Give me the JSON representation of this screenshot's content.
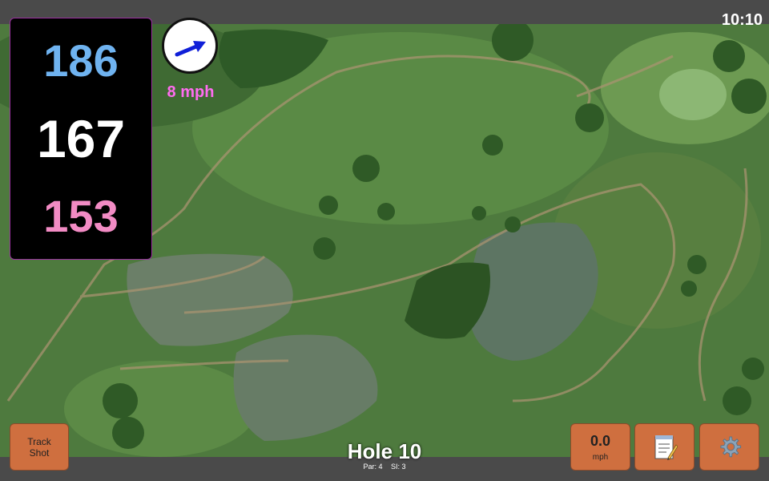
{
  "status": {
    "time": "10:10"
  },
  "distances": {
    "back": "186",
    "middle": "167",
    "front": "153",
    "colors": {
      "back": "#6fb3f0",
      "middle": "#ffffff",
      "front": "#f28bc4"
    }
  },
  "wind": {
    "speed": "8 mph",
    "arrow_color": "#1020d8",
    "speed_color": "#ff6cf0",
    "arrow_icon": "wind-direction-arrow"
  },
  "buttons": {
    "track_shot_line1": "Track",
    "track_shot_line2": "Shot",
    "speed_value": "0.0",
    "speed_unit": "mph",
    "notes_icon": "notepad-icon",
    "settings_icon": "gear-icon",
    "color": "#cf6f3f"
  },
  "hole": {
    "title": "Hole 10",
    "par": "Par: 4",
    "si": "SI: 3"
  }
}
